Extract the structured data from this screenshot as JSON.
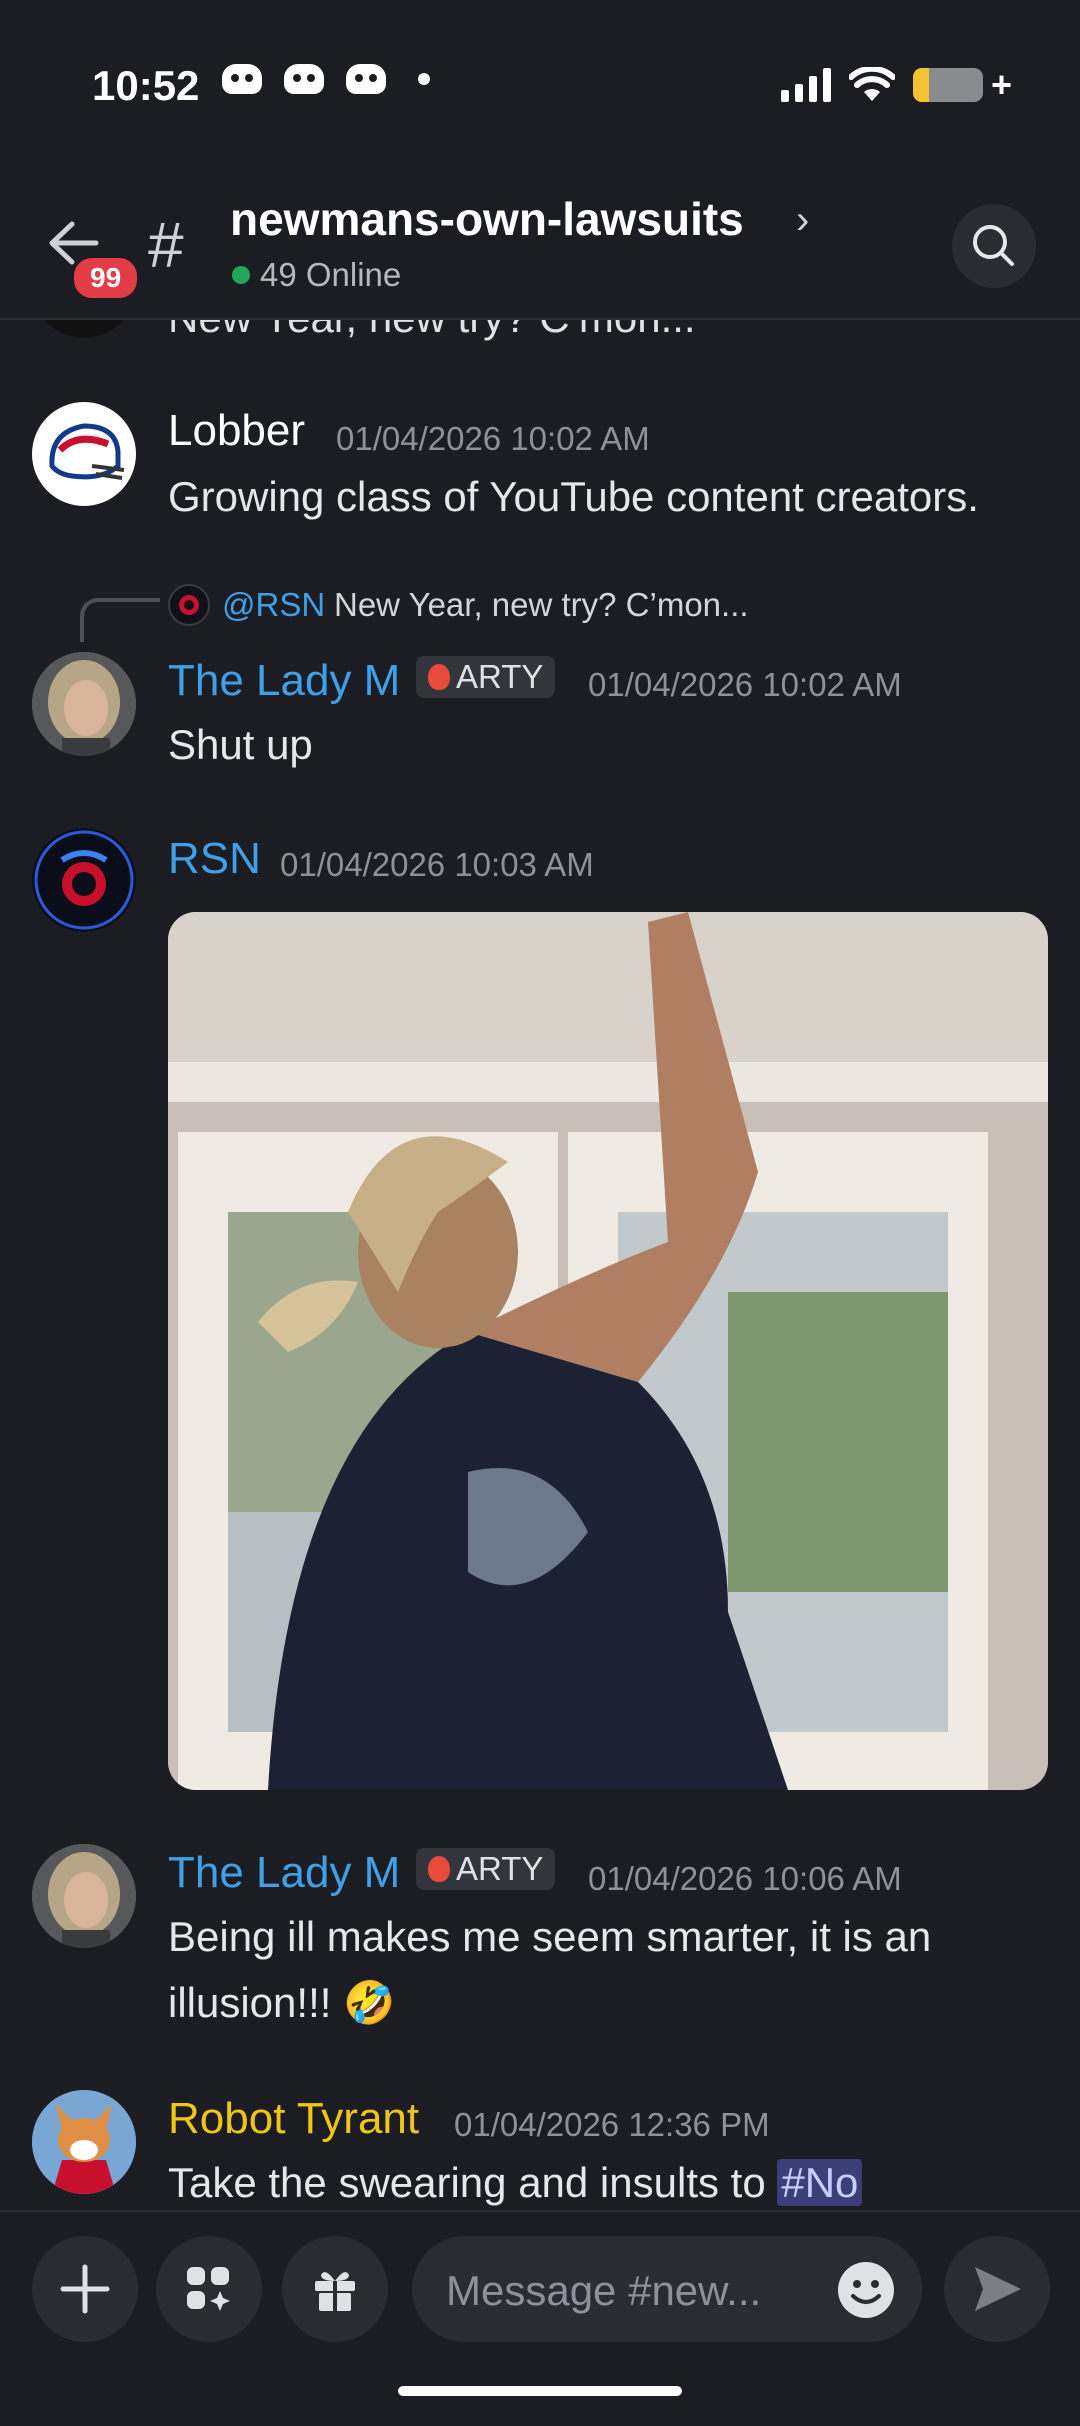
{
  "status_bar": {
    "time": "10:52"
  },
  "header": {
    "unread_badge": "99",
    "channel_prefix": "#",
    "channel_name": "newmans-own-lawsuits",
    "chevron": "›",
    "online": "49 Online"
  },
  "messages": {
    "cut_text": "New Year, new try? C’mon...",
    "m1": {
      "user": "Lobber",
      "time": "01/04/2026 10:02 AM",
      "text": "Growing class of YouTube content creators.",
      "color": "#ffffff"
    },
    "reply": {
      "mention": "@RSN",
      "preview": "New Year, new try? C’mon..."
    },
    "m2": {
      "user": "The Lady M",
      "tag": "ARTY",
      "time": "01/04/2026 10:02 AM",
      "text": "Shut up",
      "color": "#3ea0e8"
    },
    "m3": {
      "user": "RSN",
      "time": "01/04/2026 10:03 AM",
      "color": "#3ea0e8"
    },
    "m4": {
      "user": "The Lady M",
      "tag": "ARTY",
      "time": "01/04/2026 10:06 AM",
      "text_line1": "Being ill makes me seem smarter, it is an",
      "text_line2": "illusion!!!",
      "emoji": "🤣",
      "color": "#3ea0e8"
    },
    "m5": {
      "user": "Robot Tyrant",
      "time": "01/04/2026 12:36 PM",
      "text": "Take the swearing and insults to",
      "channel_link": "#No",
      "color": "#f0c419"
    }
  },
  "composer": {
    "placeholder": "Message #new..."
  }
}
